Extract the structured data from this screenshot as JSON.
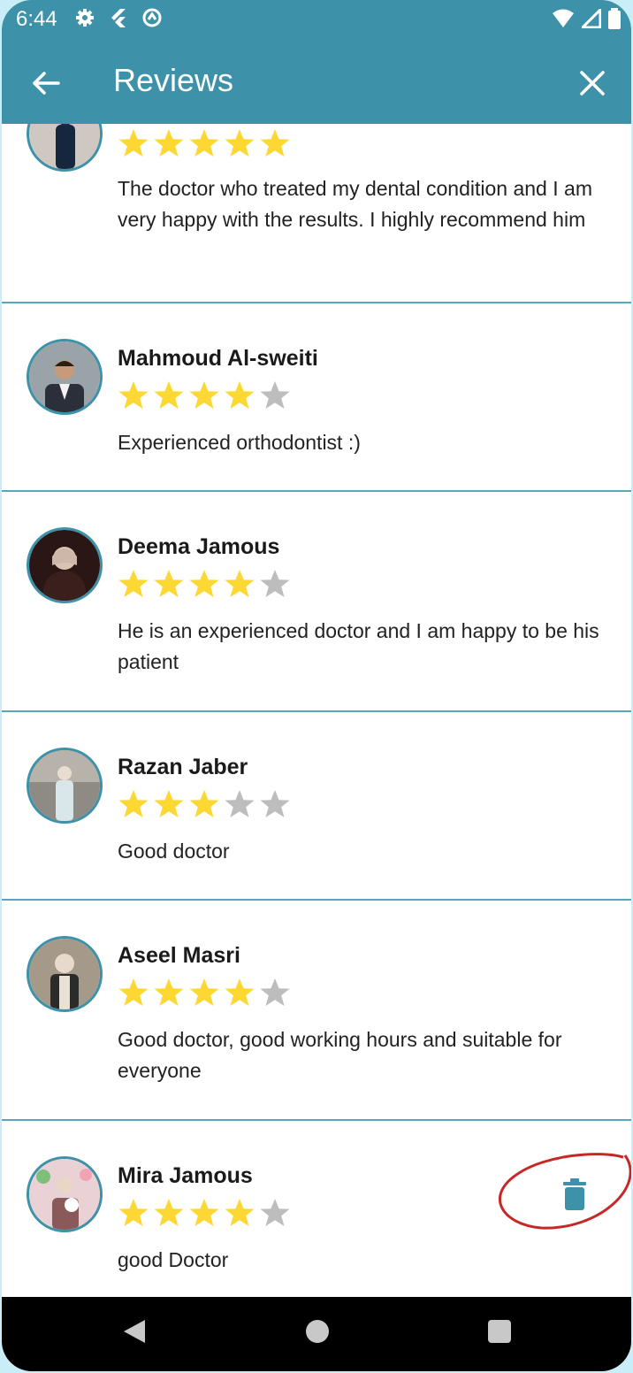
{
  "status_bar": {
    "time": "6:44"
  },
  "app_bar": {
    "title": "Reviews"
  },
  "reviews": [
    {
      "name": "",
      "rating": 5,
      "comment": "The doctor who treated my dental condition and I am very happy with the results. I highly recommend him"
    },
    {
      "name": "Mahmoud Al-sweiti",
      "rating": 4,
      "comment": "Experienced orthodontist :)"
    },
    {
      "name": "Deema Jamous",
      "rating": 4,
      "comment": "He is an experienced doctor and I am happy to be his patient"
    },
    {
      "name": "Razan Jaber",
      "rating": 3,
      "comment": "Good doctor"
    },
    {
      "name": "Aseel Masri",
      "rating": 4,
      "comment": "Good doctor, good working hours and suitable for everyone"
    },
    {
      "name": "Mira Jamous",
      "rating": 4,
      "comment": "good Doctor"
    }
  ],
  "colors": {
    "primary": "#3d91a8",
    "star_filled": "#fdd835",
    "star_empty": "#bdbdbd",
    "annotation": "#c62828"
  },
  "icons": {
    "back": "arrow-left-icon",
    "close": "close-icon",
    "delete": "trash-icon"
  }
}
